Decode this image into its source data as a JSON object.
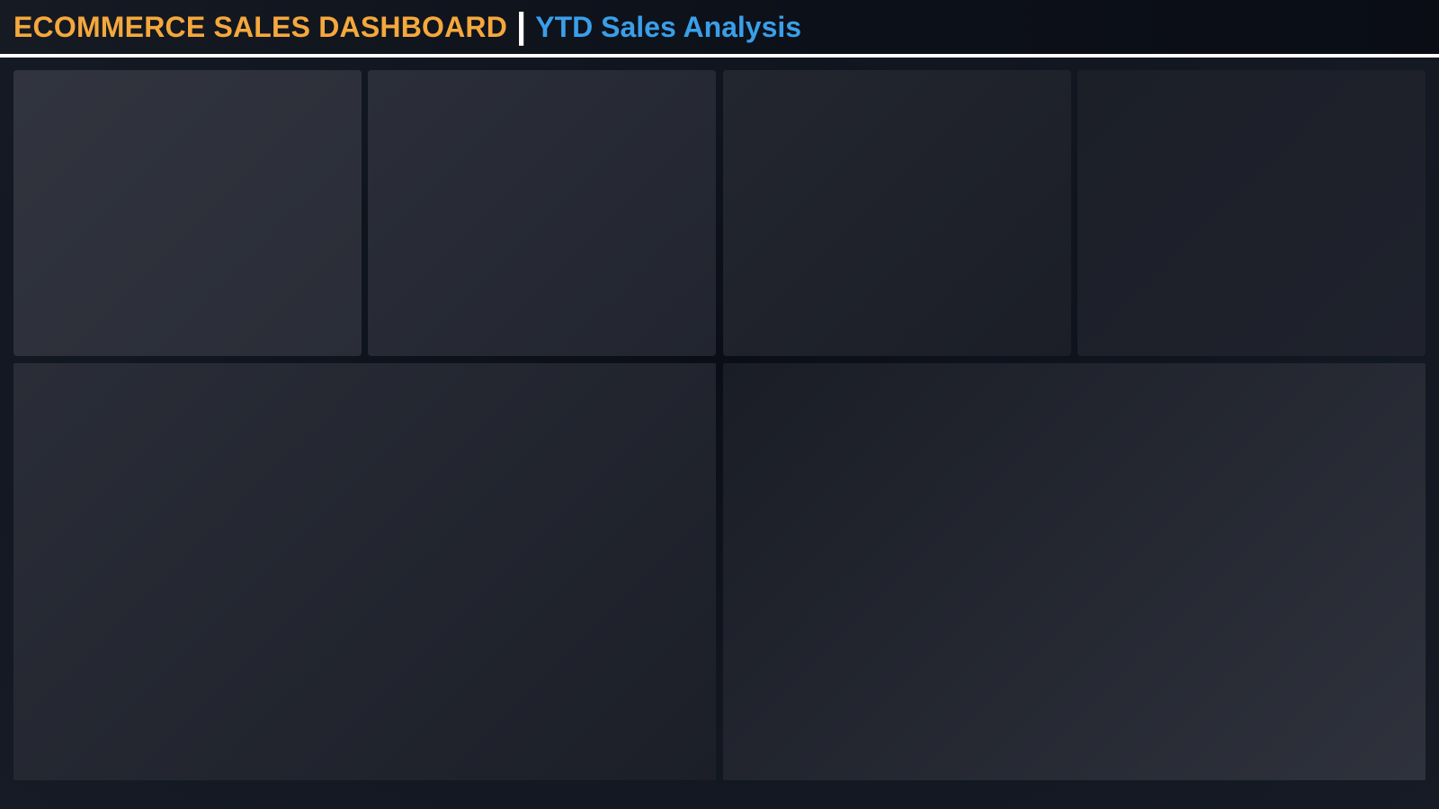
{
  "header": {
    "title": "ECOMMERCE SALES DASHBOARD",
    "separator": "|",
    "subtitle": "YTD Sales Analysis"
  },
  "colors": {
    "title": "#f5a83c",
    "subtitle": "#3a9fe8",
    "separator": "#ffffff",
    "header_rule": "#ffffff",
    "background": "#0f131c",
    "panel": "#2a2d37"
  },
  "panels": {
    "kpi_cards": [
      "",
      "",
      "",
      ""
    ],
    "charts": [
      "",
      ""
    ]
  }
}
